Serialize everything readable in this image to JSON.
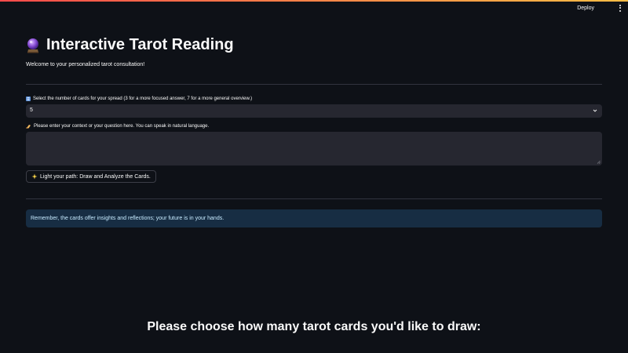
{
  "header": {
    "deploy_label": "Deploy",
    "menu_icon": "vertical-dots-icon"
  },
  "main": {
    "title_icon": "crystal-ball-icon",
    "title": "Interactive Tarot Reading",
    "subtitle": "Welcome to your personalized tarot consultation!",
    "card_count": {
      "icon": "number-keycap-icon",
      "label": "Select the number of cards for your spread (3 for a more focused answer, 7 for a more general overview.)",
      "value": "5"
    },
    "context": {
      "icon": "writing-hand-icon",
      "label": "Please enter your context or your question here. You can speak in natural language.",
      "value": ""
    },
    "draw_button": {
      "icon": "sparkles-icon",
      "label": "Light your path: Draw and Analyze the Cards."
    },
    "info_message": "Remember, the cards offer insights and reflections; your future is in your hands."
  },
  "footer_caption": "Please choose how many tarot cards you'd like to draw:",
  "colors": {
    "background": "#0e1117",
    "input_bg": "#262730",
    "info_bg": "#172d43",
    "info_text": "#c7ebff",
    "divider": "#31333f"
  }
}
